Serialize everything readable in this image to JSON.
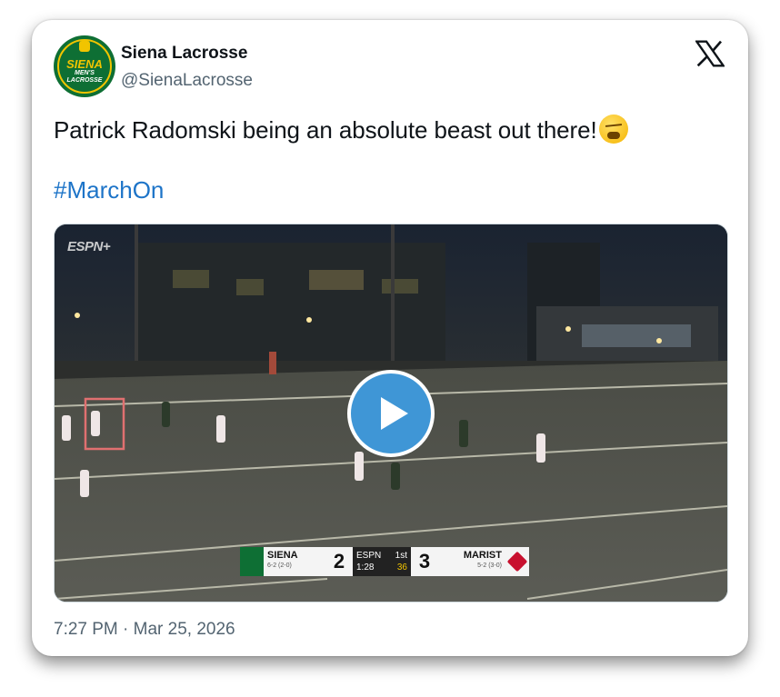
{
  "account": {
    "display_name": "Siena Lacrosse",
    "handle": "@SienaLacrosse",
    "avatar_text": [
      "SIENA",
      "MEN'S",
      "LACROSSE"
    ]
  },
  "tweet": {
    "text": "Patrick Radomski being an absolute beast out there!",
    "emoji": "face-with-steam-from-nose-emoji",
    "hashtag": "#MarchOn",
    "timestamp": "7:27 PM · Mar 25, 2026"
  },
  "video": {
    "broadcaster": "ESPN+",
    "scoreboard": {
      "home_team": "SIENA",
      "home_record": "6-2 (2-0)",
      "home_score": "2",
      "network": "ESPN",
      "clock": "1:28",
      "period": "1st",
      "shot_clock": "36",
      "away_score": "3",
      "away_team": "MARIST",
      "away_record": "5-2 (3-0)"
    }
  },
  "colors": {
    "link": "#1d74c8",
    "play_button": "#3f96d6",
    "siena_green": "#0e6f34",
    "siena_gold": "#f1c400",
    "marist_red": "#c8102e"
  }
}
